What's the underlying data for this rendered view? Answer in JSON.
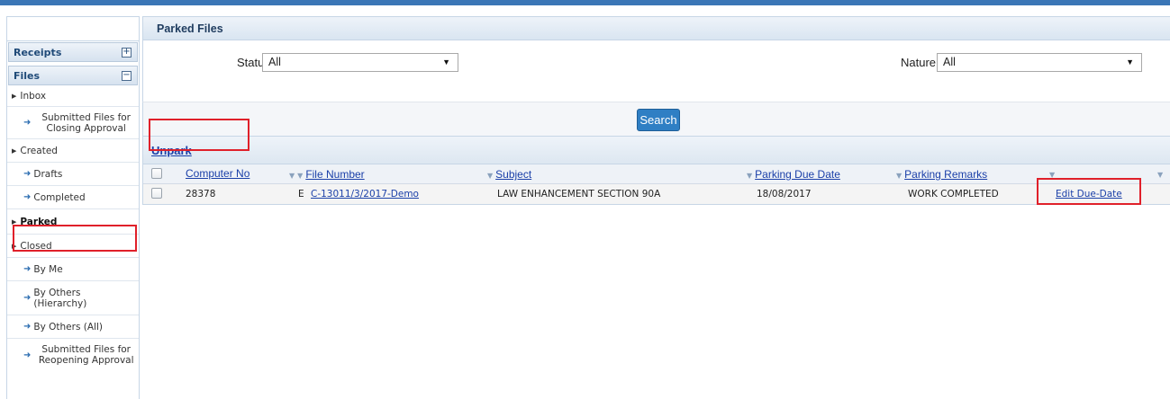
{
  "sidebar": {
    "receipts_label": "Receipts",
    "files_label": "Files",
    "items": [
      {
        "label": "Inbox"
      },
      {
        "label": "Submitted Files for Closing Approval"
      },
      {
        "label": "Created"
      },
      {
        "label": "Drafts"
      },
      {
        "label": "Completed"
      },
      {
        "label": "Parked"
      },
      {
        "label": "Closed"
      },
      {
        "label": "By Me"
      },
      {
        "label": "By Others (Hierarchy)"
      },
      {
        "label": "By Others (All)"
      },
      {
        "label": "Submitted Files for Reopening Approval"
      }
    ]
  },
  "main": {
    "title": "Parked Files",
    "filters": {
      "status_label": "Status",
      "status_value": "All",
      "nature_label": "Nature",
      "nature_value": "All"
    },
    "search_label": "Search",
    "unpark_label": "Unpark",
    "columns": [
      "Computer No",
      "File Number",
      "Subject",
      "Parking Due Date",
      "Parking Remarks"
    ],
    "rows": [
      {
        "computer_no": "28378",
        "type": "E",
        "file_number": "C-13011/3/2017-Demo",
        "subject": "LAW ENHANCEMENT SECTION 90A",
        "due_date": "18/08/2017",
        "remarks": "WORK COMPLETED",
        "action": "Edit Due-Date"
      }
    ]
  },
  "colors": {
    "accent": "#3b76b6",
    "link": "#1a3fa8",
    "highlight": "#e0202a",
    "button": "#2f7fc4"
  }
}
